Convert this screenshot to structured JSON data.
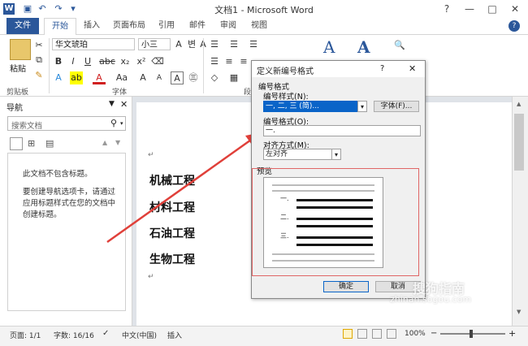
{
  "window": {
    "title": "文档1 - Microsoft Word",
    "help": "?",
    "minimize": "—",
    "restore": "□",
    "close": "✕"
  },
  "qat": {
    "logo": "W",
    "save": "💾",
    "undo": "↶",
    "redo": "↷",
    "customize": "▾"
  },
  "tabs": [
    "文件",
    "开始",
    "插入",
    "页面布局",
    "引用",
    "邮件",
    "审阅",
    "视图"
  ],
  "ribbon": {
    "paste_label": "粘贴",
    "font_name": "华文琥珀",
    "font_size": "小三",
    "group_clipboard": "剪贴板",
    "group_font": "字体",
    "group_paragraph": "段",
    "font_buttons": [
      "B",
      "I",
      "U",
      "abc",
      "x₂",
      "x²"
    ],
    "font_buttons2": [
      "A",
      "A",
      "Aa",
      "A",
      "A"
    ],
    "para_buttons": [
      "☰",
      "☰",
      "☰",
      "☰"
    ]
  },
  "nav": {
    "title": "导航",
    "search_placeholder": "搜索文档",
    "no_headings": "此文档不包含标题。",
    "hint": "要创建导航选项卡，请通过应用标题样式在您的文档中创建标题。"
  },
  "document": {
    "lines": [
      "机械工程",
      "材料工程",
      "石油工程",
      "生物工程"
    ]
  },
  "dialog": {
    "title": "定义新编号格式",
    "help": "?",
    "close": "✕",
    "section_label": "编号格式",
    "style_label": "编号样式(N):",
    "style_value": "一, 二, 三 (简)...",
    "font_button": "字体(F)...",
    "format_label": "编号格式(O):",
    "format_value": "一.",
    "align_label": "对齐方式(M):",
    "align_value": "左对齐",
    "preview_label": "预览",
    "preview_items": [
      "一.",
      "二.",
      "三."
    ],
    "ok": "确定",
    "cancel": "取消"
  },
  "status": {
    "page": "页面: 1/1",
    "words": "字数: 16/16",
    "language": "中文(中国)",
    "insert": "插入",
    "zoom": "100%"
  },
  "watermark": {
    "brand": "搜狗指南",
    "url": "zhinan.sogou.com"
  },
  "colors": {
    "accent": "#2b579a",
    "arrow": "#e0403a",
    "highlight": "#e06666",
    "selection": "#0a64c8"
  }
}
